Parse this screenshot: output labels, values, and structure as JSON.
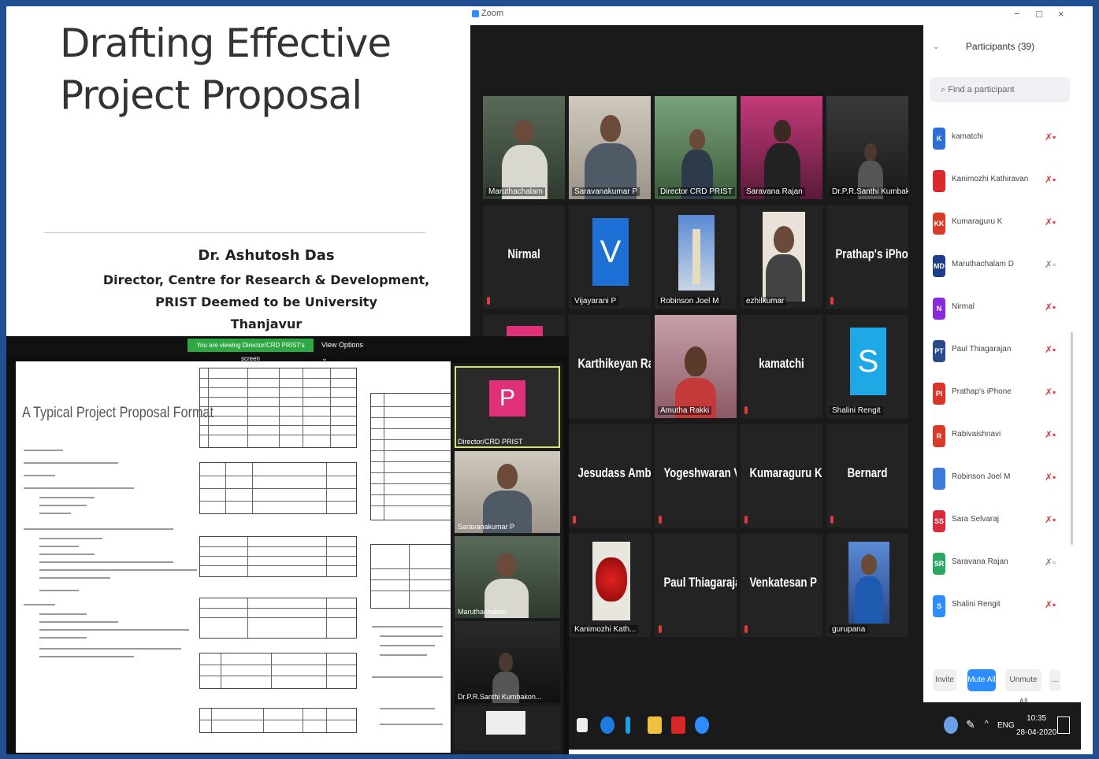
{
  "slide": {
    "title_line1": "Drafting Effective",
    "title_line2": "Project Proposal",
    "author": "Dr. Ashutosh Das",
    "role": "Director, Centre for Research & Development,",
    "institution": "PRIST Deemed to be University",
    "city": "Thanjavur"
  },
  "zoom": {
    "window_title": "Zoom",
    "window_controls": [
      "−",
      "□",
      "×"
    ]
  },
  "gallery": {
    "tiles": [
      {
        "label": "Maruthachalam"
      },
      {
        "label": "Saravanakumar P"
      },
      {
        "label": "Director CRD PRIST"
      },
      {
        "label": "Saravana Rajan"
      },
      {
        "label": "Dr.P.R.Santhi Kumbak..."
      },
      {
        "name": "Nirmal"
      },
      {
        "label": "Vijayarani P",
        "letter": "V"
      },
      {
        "label": "Robinson Joel M"
      },
      {
        "label": "ezhilkumar"
      },
      {
        "name": "Prathap's iPhone"
      },
      {
        "name": ""
      },
      {
        "name": "Karthikeyan Ra..."
      },
      {
        "label": "Amutha Rakki"
      },
      {
        "name": "kamatchi"
      },
      {
        "label": "Shalini Rengit",
        "letter": "S"
      },
      {
        "name": "Jesudass Ambr..."
      },
      {
        "name": "Yogeshwaran V"
      },
      {
        "name": "Kumaraguru K"
      },
      {
        "name": "Bernard"
      },
      {
        "label": "Kanimozhi Kath..."
      },
      {
        "name": "Paul Thiagarajan"
      },
      {
        "name": "Venkatesan P"
      },
      {
        "label": "gurupana"
      }
    ]
  },
  "participants": {
    "title": "Participants (39)",
    "search_placeholder": "Find a participant",
    "list": [
      {
        "initials": "K",
        "name": "kamatchi",
        "color": "#2d6fd6"
      },
      {
        "initials": "",
        "name": "Kanimozhi Kathiravan",
        "color": "#d92b2b"
      },
      {
        "initials": "KK",
        "name": "Kumaraguru K",
        "color": "#d93b2b"
      },
      {
        "initials": "MD",
        "name": "Maruthachalam D",
        "color": "#1c3e8a"
      },
      {
        "initials": "N",
        "name": "Nirmal",
        "color": "#8a2bd9"
      },
      {
        "initials": "PT",
        "name": "Paul Thiagarajan",
        "color": "#2b4a8a"
      },
      {
        "initials": "PI",
        "name": "Prathap's iPhone",
        "color": "#d9352b"
      },
      {
        "initials": "R",
        "name": "Rabivaishnavi",
        "color": "#d93b2b"
      },
      {
        "initials": "",
        "name": "Robinson Joel M",
        "color": "#3a7ad9"
      },
      {
        "initials": "SS",
        "name": "Sara Selvaraj",
        "color": "#d92b3b"
      },
      {
        "initials": "SR",
        "name": "Saravana Rajan",
        "color": "#2ba866"
      },
      {
        "initials": "S",
        "name": "Shalini Rengit",
        "color": "#2d8cff"
      }
    ],
    "buttons": {
      "invite": "Invite",
      "mute_all": "Mute All",
      "unmute_all": "Unmute All"
    }
  },
  "taskbar": {
    "lang": "ENG",
    "time": "10:35",
    "date": "28-04-2020"
  },
  "share": {
    "banner": "You are viewing Director/CRD PRIST's screen",
    "view_options": "View Options ⌄",
    "doc_heading": "A Typical Project Proposal Format",
    "strip": [
      {
        "label": "Director/CRD PRIST",
        "letter": "P"
      },
      {
        "label": "Saravanakumar P"
      },
      {
        "label": "Maruthachalam"
      },
      {
        "label": "Dr.P.R.Santhi Kumbakon..."
      }
    ]
  }
}
